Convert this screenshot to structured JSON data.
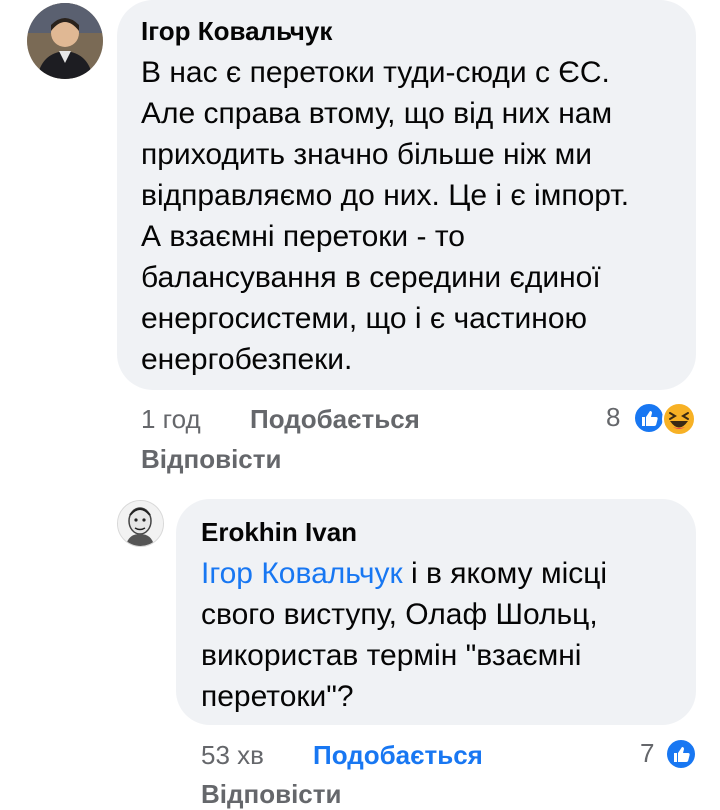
{
  "comments": [
    {
      "author": "Ігор Ковальчук",
      "text_lines": [
        "В нас є перетоки туди-сюди с ЄС.",
        "Але справа втому, що від них нам",
        "приходить значно більше ніж ми",
        "відправляємо до них. Це і є імпорт.",
        "А взаємні перетоки - то",
        "балансування в середини єдиної",
        "енергосистеми, що і є частиною",
        "енергобезпеки."
      ],
      "time": "1 год",
      "like_label": "Подобається",
      "reply_label": "Відповісти",
      "reaction_count": "8",
      "reactions": [
        "like-icon",
        "laugh-icon"
      ]
    },
    {
      "author": "Erokhin Ivan",
      "mention": "Ігор Ковальчук",
      "text_first_rest": " і в якому місці",
      "text_lines": [
        "свого виступу, Олаф Шольц,",
        "використав термін \"взаємні",
        "перетоки\"?"
      ],
      "time": "53 хв",
      "like_label": "Подобається",
      "reply_label": "Відповісти",
      "reaction_count": "7",
      "reactions": [
        "like-icon"
      ]
    }
  ],
  "colors": {
    "bubble": "#f0f2f5",
    "meta": "#65676b",
    "link": "#1877f2"
  }
}
